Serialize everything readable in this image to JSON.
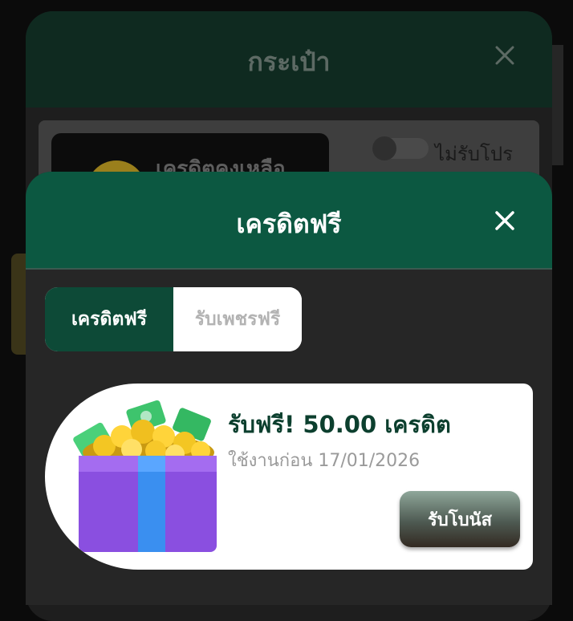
{
  "wallet_modal": {
    "title": "กระเป๋า",
    "credit_label": "เครดิตคงเหลือ",
    "promo_toggle_label": "ไม่รับโปร"
  },
  "free_credit_modal": {
    "title": "เครดิตฟรี",
    "tabs": [
      {
        "label": "เครดิตฟรี",
        "active": true
      },
      {
        "label": "รับเพชรฟรี",
        "active": false
      }
    ],
    "bonus": {
      "title": "รับฟรี! 50.00 เครดิต",
      "expiry": "ใช้งานก่อน 17/01/2026",
      "claim_label": "รับโบนัส"
    }
  },
  "colors": {
    "header_green": "#0c5841",
    "active_tab": "#0d4a37",
    "bonus_title": "#0c3f2e"
  },
  "icons": [
    "close-icon",
    "coin-icon",
    "gift-box-icon"
  ]
}
